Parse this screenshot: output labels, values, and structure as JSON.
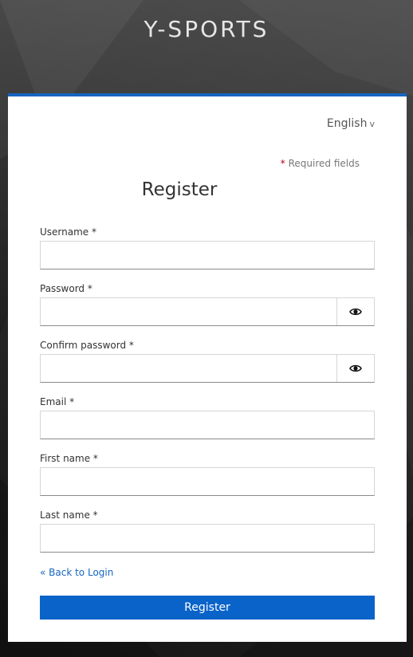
{
  "brand": {
    "title": "Y-SPORTS"
  },
  "language": {
    "selected": "English",
    "chevron": "v"
  },
  "required_note": {
    "star": "*",
    "text": "Required fields"
  },
  "form": {
    "title": "Register",
    "fields": [
      {
        "label": "Username *",
        "value": "",
        "type": "text"
      },
      {
        "label": "Password *",
        "value": "",
        "type": "password",
        "icon": "eye-icon"
      },
      {
        "label": "Confirm password *",
        "value": "",
        "type": "password",
        "icon": "eye-icon"
      },
      {
        "label": "Email *",
        "value": "",
        "type": "email"
      },
      {
        "label": "First name *",
        "value": "",
        "type": "text"
      },
      {
        "label": "Last name *",
        "value": "",
        "type": "text"
      }
    ],
    "back_link": "« Back to Login",
    "submit_label": "Register"
  },
  "colors": {
    "accent": "#0a63c9",
    "required_star": "#b00020",
    "background": "#2f2f2f"
  }
}
